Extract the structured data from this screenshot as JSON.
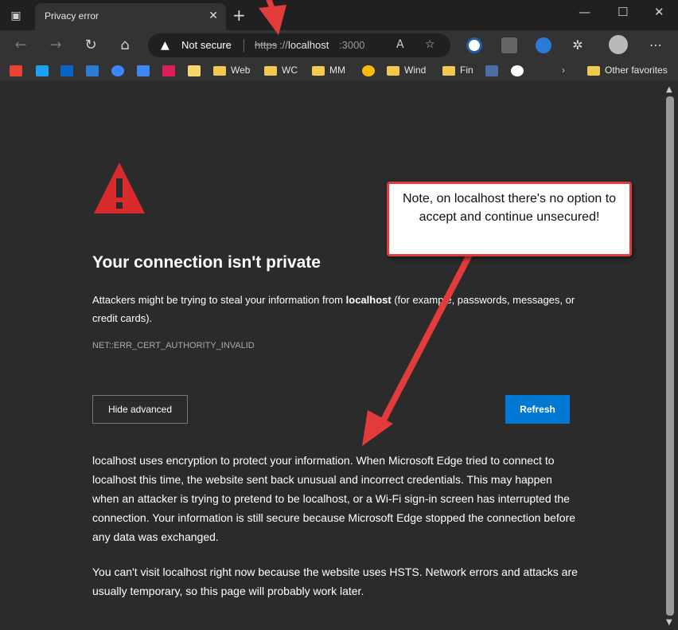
{
  "tab": {
    "title": "Privacy error"
  },
  "address": {
    "status": "Not secure",
    "scheme": "https",
    "separator": "://",
    "host": "localhost",
    "port": ":3000"
  },
  "favorites": {
    "items": [
      {
        "label": "Web"
      },
      {
        "label": "WC"
      },
      {
        "label": "MM"
      },
      {
        "label": "Wind"
      },
      {
        "label": "Fin"
      }
    ],
    "other": "Other favorites"
  },
  "page": {
    "heading": "Your connection isn't private",
    "intro_before": "Attackers might be trying to steal your information from ",
    "intro_host": "localhost",
    "intro_after": " (for example, passwords, messages, or credit cards).",
    "error_code": "NET::ERR_CERT_AUTHORITY_INVALID",
    "hide_advanced": "Hide advanced",
    "refresh": "Refresh",
    "details": "localhost uses encryption to protect your information. When Microsoft Edge tried to connect to localhost this time, the website sent back unusual and incorrect credentials. This may happen when an attacker is trying to pretend to be localhost, or a Wi-Fi sign-in screen has interrupted the connection. Your information is still secure because Microsoft Edge stopped the connection before any data was exchanged.",
    "hsts": "You can't visit localhost right now because the website uses HSTS. Network errors and attacks are usually temporary, so this page will probably work later."
  },
  "annotation": {
    "note": "Note, on localhost there's no option to accept and continue unsecured!"
  },
  "colors": {
    "accent": "#0078d4",
    "warning_red": "#d92b2b",
    "annotation_red": "#e23b3b"
  }
}
